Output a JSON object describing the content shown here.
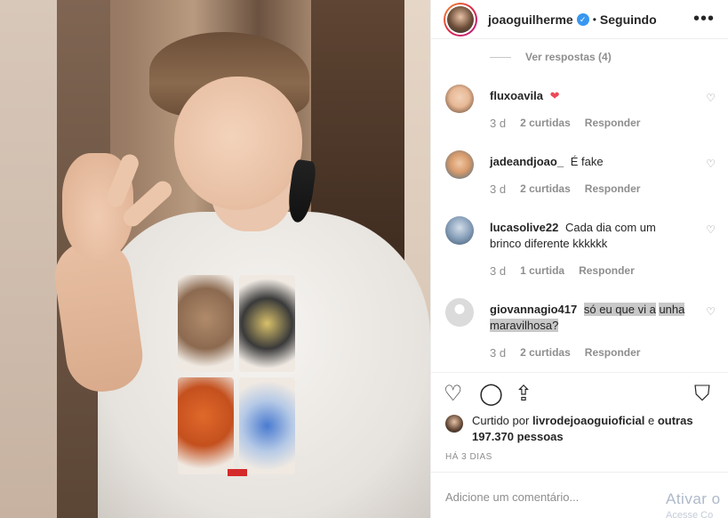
{
  "header": {
    "username": "joaoguilherme",
    "verified_mark": "✓",
    "separator": "•",
    "follow_status": "Seguindo",
    "more_icon": "•••"
  },
  "comments": {
    "view_replies": "Ver respostas (4)",
    "items": [
      {
        "user": "fluxoavila",
        "text": "",
        "emoji": "❤",
        "when": "3 d",
        "likes": "2 curtidas",
        "reply": "Responder",
        "avatar_color": "#e8b996"
      },
      {
        "user": "jadeandjoao_",
        "text": "É fake",
        "emoji": "",
        "when": "3 d",
        "likes": "2 curtidas",
        "reply": "Responder",
        "avatar_color": "#d79a6b"
      },
      {
        "user": "lucasolive22",
        "text": "Cada dia com um brinco diferente kkkkkk",
        "emoji": "",
        "when": "3 d",
        "likes": "1 curtida",
        "reply": "Responder",
        "avatar_color": "#5b7fa3"
      },
      {
        "user": "giovannagio417",
        "text_pre": "só eu que vi a",
        "text_post": "unha maravilhosa?",
        "when": "3 d",
        "likes": "2 curtidas",
        "reply": "Responder",
        "avatar_color": "#dbdbdb"
      }
    ],
    "heart_icon": "♡"
  },
  "actions": {
    "like_icon": "♡",
    "comment_icon": "◯",
    "share_icon": "⇪",
    "save_icon": "⛉"
  },
  "likes": {
    "prefix": "Curtido por",
    "user": "livrodejoaoguioficial",
    "mid": "e",
    "others": "outras 197.370 pessoas"
  },
  "time": "HÁ 3 DIAS",
  "add_comment": {
    "placeholder": "Adicione um comentário...",
    "watermark": "Ativar o",
    "watermark_sub": "Acesse Co"
  },
  "colors": {
    "verified": "#3897f0",
    "red_heart": "#ed4956",
    "muted_text": "#8e8e8e"
  }
}
